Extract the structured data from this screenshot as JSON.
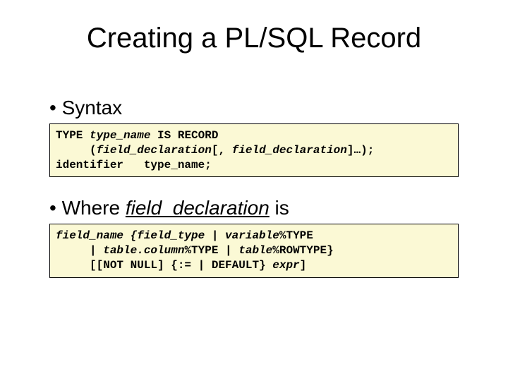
{
  "title": "Creating a PL/SQL Record",
  "bullet1": "• Syntax",
  "code1": {
    "l1a": "TYPE ",
    "l1b": "type_name",
    "l1c": " IS RECORD",
    "l2a": "     (",
    "l2b": "field_declaration",
    "l2c": "[, ",
    "l2d": "field_declaration",
    "l2e": "]…);",
    "l3a": "identifier   type_name;"
  },
  "bullet2_a": "• Where ",
  "bullet2_b": "field_declaration",
  "bullet2_c": " is",
  "code2": {
    "l1a": "field_name {field_type | variable",
    "l1b": "%TYPE",
    "l2a": "     | ",
    "l2b": "table.column",
    "l2c": "%TYPE | ",
    "l2d": "table",
    "l2e": "%ROWTYPE}",
    "l3a": "     [[NOT NULL] {:= | DEFAULT} ",
    "l3b": "expr",
    "l3c": "]"
  }
}
